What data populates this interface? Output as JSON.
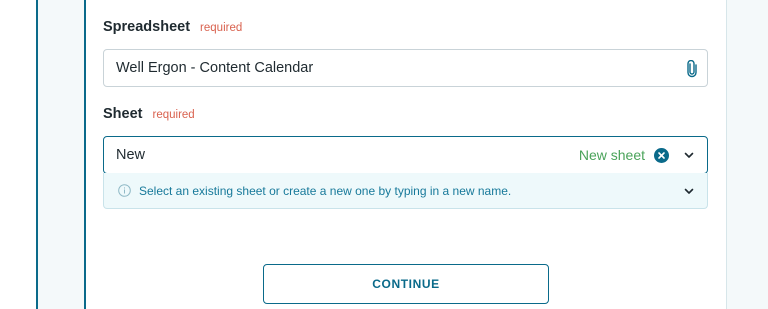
{
  "spreadsheet": {
    "label": "Spreadsheet",
    "required_text": "required",
    "value": "Well Ergon - Content Calendar",
    "icon": "paperclip-icon"
  },
  "sheet": {
    "label": "Sheet",
    "required_text": "required",
    "value": "New",
    "new_sheet_tag": "New sheet",
    "clear_icon": "clear-circle-icon",
    "dropdown_icon": "chevron-down-icon",
    "hint": "Select an existing sheet or create a new one by typing in a new name."
  },
  "actions": {
    "continue_label": "CONTINUE"
  },
  "colors": {
    "accent": "#0a6a8a",
    "required": "#d9624f",
    "new_tag": "#4aa35a",
    "hint_bg": "#eef9fb",
    "hint_text": "#17799a"
  }
}
